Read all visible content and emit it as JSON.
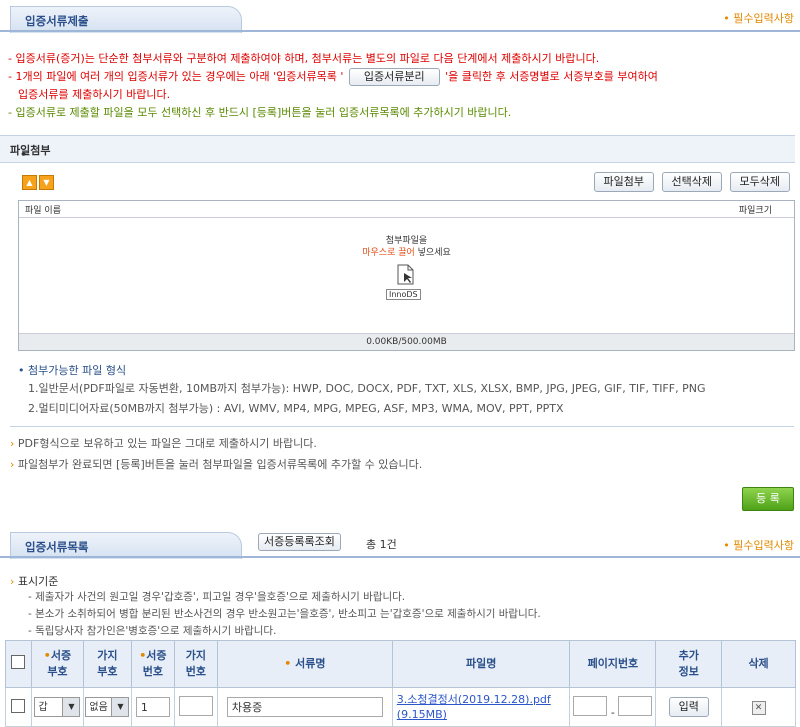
{
  "submit_section": {
    "tab_title": "입증서류제출",
    "required_note": "• 필수입력사항"
  },
  "notices": {
    "line1": "- 입증서류(증거)는 단순한 첨부서류와 구분하여 제출하여야 하며, 첨부서류는 별도의 파일로 다음 단계에서 제출하시기 바랍니다.",
    "line2_pre": "- 1개의 파일에 여러 개의 입증서류가 있는 경우에는 아래 '입증서류목록 '",
    "split_button": "입증서류분리",
    "line2_post": "'을 클릭한 후 서증명별로 서증부호를 부여하여",
    "line3": "입증서류를 제출하시기 바랍니다.",
    "line4": "- 입증서류로 제출할 파일을 모두 선택하신 후 반드시 [등록]버튼을 눌러 입증서류목록에 추가하시기 바랍니다."
  },
  "attach_section": {
    "title": "파일첨부",
    "buttons": [
      "파일첨부",
      "선택삭제",
      "모두삭제"
    ],
    "col_filename": "파일 이름",
    "col_filesize": "파일크기",
    "drop_line1": "첨부파일을",
    "drop_line2_highlight": "마우스로 끌어",
    "drop_line2_rest": " 넣으세요",
    "drop_logo": "InnoDS",
    "usage": "0.00KB/500.00MB"
  },
  "formats": {
    "title": "첨부가능한 파일 형식",
    "line1": "1.일반문서(PDF파일로 자동변환, 10MB까지 첨부가능): HWP, DOC, DOCX, PDF, TXT, XLS, XLSX, BMP, JPG, JPEG, GIF, TIF, TIFF, PNG",
    "line2": "2.멀티미디어자료(50MB까지 첨부가능) : AVI, WMV, MP4, MPG, MPEG, ASF, MP3, WMA, MOV, PPT, PPTX"
  },
  "tips": [
    "PDF형식으로 보유하고 있는 파일은 그대로 제출하시기 바랍니다.",
    "파일첨부가 완료되면 [등록]버튼을 눌러 첨부파일을 입증서류목록에 추가할 수 있습니다."
  ],
  "register_button": "등 록",
  "list_section": {
    "tab_title": "입증서류목록",
    "lookup_button": "서증등록록조회",
    "total": "총 1건",
    "required_note": "• 필수입력사항",
    "criteria_title": "표시기준",
    "criteria": [
      "- 제출자가 사건의 원고일 경우'갑호증', 피고일 경우'을호증'으로 제출하시기 바랍니다.",
      "- 본소가 소취하되어 병합 분리된 반소사건의 경우 반소원고는'을호증', 반소피고 는'갑호증'으로 제출하시기 바랍니다.",
      "- 독립당사자 참가인은'병호증'으로 제출하시기 바랍니다."
    ]
  },
  "table": {
    "headers": {
      "seo_code_1": "서증",
      "seo_code_2": "부호",
      "branch_code_1": "가지",
      "branch_code_2": "부호",
      "seo_no_1": "서증",
      "seo_no_2": "번호",
      "branch_no_1": "가지",
      "branch_no_2": "번호",
      "doc_name": "서류명",
      "file_name": "파일명",
      "page_no": "페이지번호",
      "extra_1": "추가",
      "extra_2": "정보",
      "delete": "삭제"
    },
    "row": {
      "seo_code": "갑",
      "branch_code": "없음",
      "seo_no": "1",
      "branch_no": "",
      "doc_name": "차용증",
      "file_line1": "3.소청결정서(2019.12.28).pdf",
      "file_line2": "(9.15MB)",
      "page_from": "",
      "page_sep": "-",
      "page_to": "",
      "extra_button": "입력",
      "delete_icon": "close-icon"
    }
  }
}
